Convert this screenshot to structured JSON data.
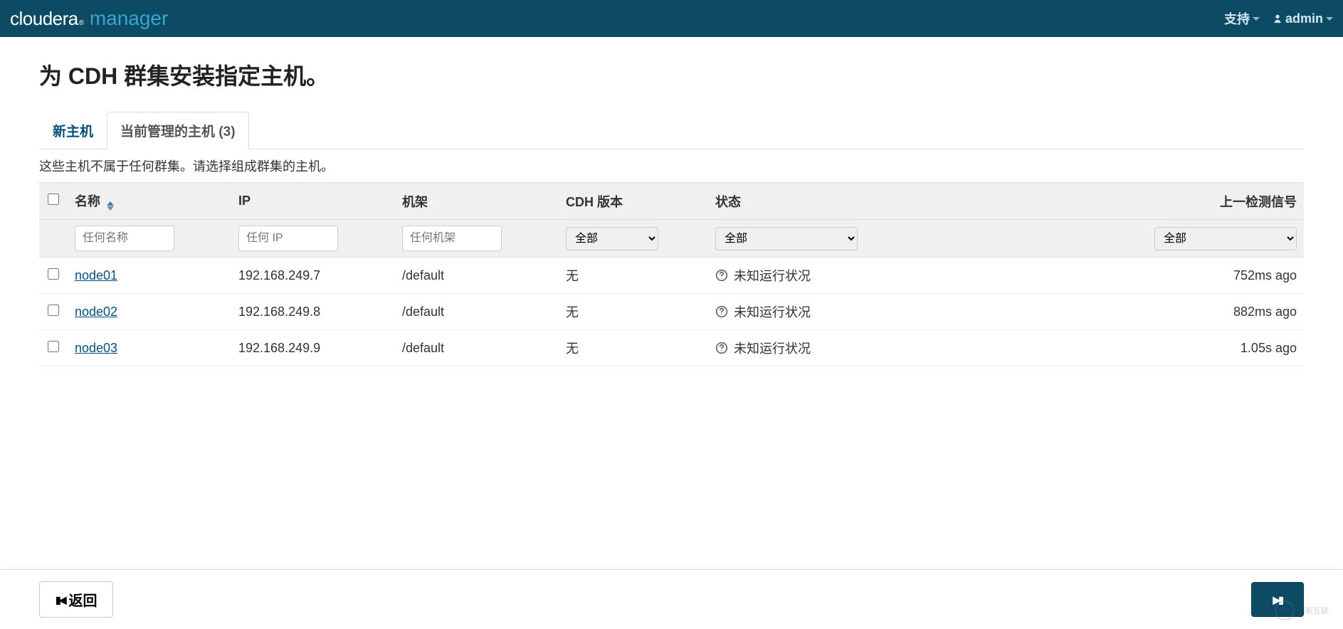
{
  "brand": {
    "cloudera": "cloudera",
    "manager": "manager"
  },
  "nav": {
    "support": "支持",
    "admin": "admin"
  },
  "page": {
    "title": "为 CDH 群集安装指定主机。",
    "tab_new": "新主机",
    "tab_managed": "当前管理的主机 (3)",
    "description": "这些主机不属于任何群集。请选择组成群集的主机。"
  },
  "columns": {
    "name": "名称",
    "ip": "IP",
    "rack": "机架",
    "version": "CDH 版本",
    "status": "状态",
    "heartbeat": "上一检测信号"
  },
  "filters": {
    "placeholder_name": "任何名称",
    "placeholder_ip": "任何 IP",
    "placeholder_rack": "任何机架",
    "option_all": "全部"
  },
  "hosts": [
    {
      "name": "node01",
      "ip": "192.168.249.7",
      "rack": "/default",
      "version": "无",
      "status": "未知运行状况",
      "heartbeat": "752ms ago"
    },
    {
      "name": "node02",
      "ip": "192.168.249.8",
      "rack": "/default",
      "version": "无",
      "status": "未知运行状况",
      "heartbeat": "882ms ago"
    },
    {
      "name": "node03",
      "ip": "192.168.249.9",
      "rack": "/default",
      "version": "无",
      "status": "未知运行状况",
      "heartbeat": "1.05s ago"
    }
  ],
  "footer": {
    "back": "返回"
  },
  "watermark": "创新互联"
}
